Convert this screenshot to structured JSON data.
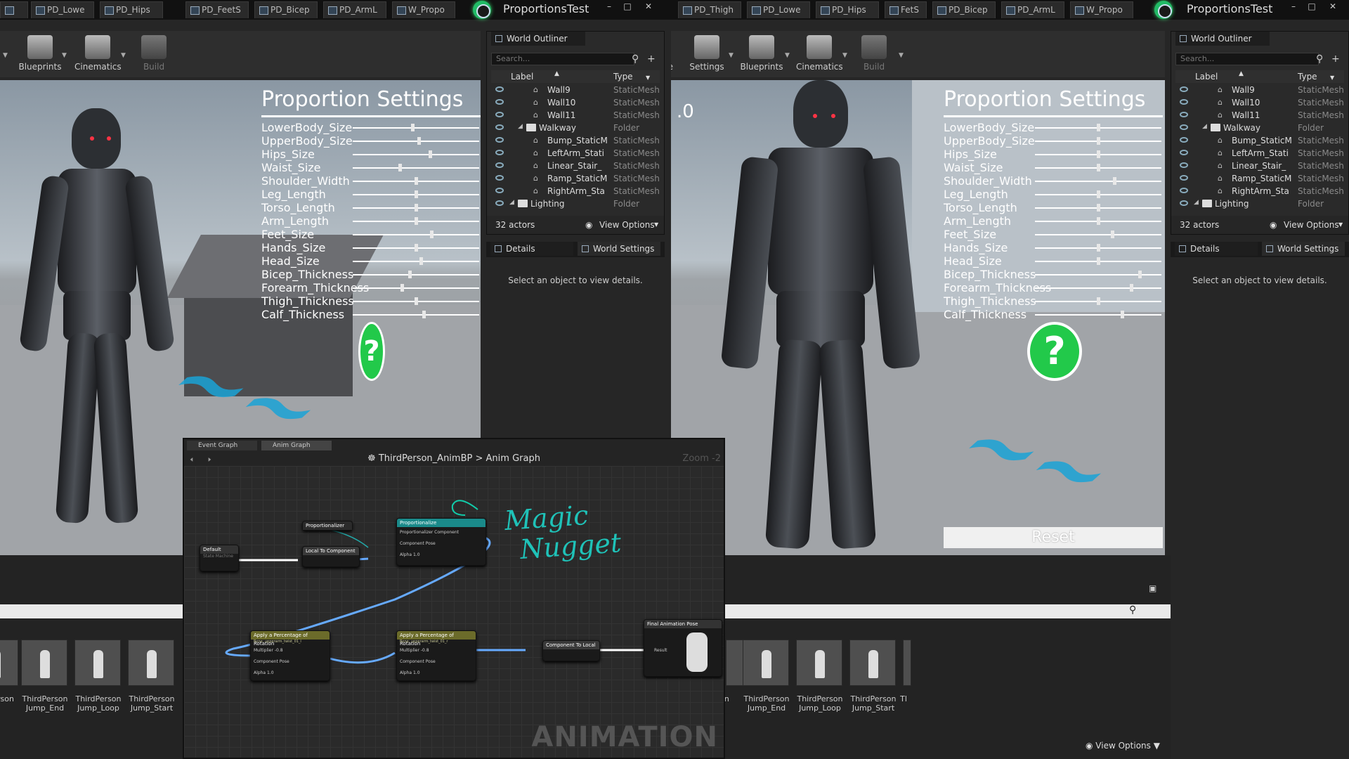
{
  "left": {
    "tabs": [
      "",
      "PD_Lowe",
      "PD_Hips",
      "PD_FeetS",
      "PD_Bicep",
      "PD_ArmL",
      "W_Propo"
    ],
    "app_title": "ProportionsTest",
    "toolbar": [
      {
        "label": "Blueprints",
        "icon": "blueprints-icon"
      },
      {
        "label": "Cinematics",
        "icon": "cinematics-icon"
      },
      {
        "label": "Build",
        "icon": "build-icon"
      }
    ],
    "viewport": {
      "title": "Proportion Settings",
      "sliders": [
        {
          "label": "LowerBody_Size",
          "value": 0.47
        },
        {
          "label": "UpperBody_Size",
          "value": 0.52
        },
        {
          "label": "Hips_Size",
          "value": 0.61
        },
        {
          "label": "Waist_Size",
          "value": 0.37
        },
        {
          "label": "Shoulder_Width",
          "value": 0.5
        },
        {
          "label": "Leg_Length",
          "value": 0.5
        },
        {
          "label": "Torso_Length",
          "value": 0.5
        },
        {
          "label": "Arm_Length",
          "value": 0.5
        },
        {
          "label": "Feet_Size",
          "value": 0.62
        },
        {
          "label": "Hands_Size",
          "value": 0.5
        },
        {
          "label": "Head_Size",
          "value": 0.54
        },
        {
          "label": "Bicep_Thickness",
          "value": 0.45
        },
        {
          "label": "Forearm_Thickness",
          "value": 0.39
        },
        {
          "label": "Thigh_Thickness",
          "value": 0.5
        },
        {
          "label": "Calf_Thickness",
          "value": 0.56
        }
      ],
      "help_icon": "?"
    },
    "outliner": {
      "tab": "World Outliner",
      "search_placeholder": "Search...",
      "col_label": "Label",
      "col_type": "Type",
      "rows": [
        {
          "label": "Wall9",
          "type": "StaticMesh",
          "kind": "mesh",
          "indent": 2
        },
        {
          "label": "Wall10",
          "type": "StaticMesh",
          "kind": "mesh",
          "indent": 2
        },
        {
          "label": "Wall11",
          "type": "StaticMesh",
          "kind": "mesh",
          "indent": 2
        },
        {
          "label": "Walkway",
          "type": "Folder",
          "kind": "folder",
          "indent": 1
        },
        {
          "label": "Bump_StaticM",
          "type": "StaticMesh",
          "kind": "mesh",
          "indent": 2
        },
        {
          "label": "LeftArm_Stati",
          "type": "StaticMesh",
          "kind": "mesh",
          "indent": 2
        },
        {
          "label": "Linear_Stair_",
          "type": "StaticMesh",
          "kind": "mesh",
          "indent": 2
        },
        {
          "label": "Ramp_StaticM",
          "type": "StaticMesh",
          "kind": "mesh",
          "indent": 2
        },
        {
          "label": "RightArm_Sta",
          "type": "StaticMesh",
          "kind": "mesh",
          "indent": 2
        },
        {
          "label": "Lighting",
          "type": "Folder",
          "kind": "folder",
          "indent": 0
        }
      ],
      "actor_count": "32 actors",
      "view_options": "View Options"
    },
    "details": {
      "tab": "Details",
      "tab2": "World Settings",
      "message": "Select an object to view details."
    },
    "content": {
      "items": [
        {
          "line1": "rson",
          "line2": ""
        },
        {
          "line1": "ThirdPerson",
          "line2": "Jump_End"
        },
        {
          "line1": "ThirdPerson",
          "line2": "Jump_Loop"
        },
        {
          "line1": "ThirdPerson",
          "line2": "Jump_Start"
        }
      ]
    }
  },
  "graph": {
    "tabs": [
      "Event Graph",
      "Anim Graph"
    ],
    "breadcrumb_root": "ThirdPerson_AnimBP",
    "breadcrumb_sep": ">",
    "breadcrumb_leaf": "Anim Graph",
    "zoom": "Zoom -2",
    "annotation_line1": "Magic",
    "annotation_line2": "Nugget",
    "watermark": "ANIMATION",
    "nodes": {
      "default": {
        "title": "Default",
        "subtitle": "State Machine"
      },
      "proportionalizer": {
        "title": "Proportionalizer"
      },
      "local_to_component": {
        "title": "Local To Component"
      },
      "proportionalize": {
        "title": "Proportionalize",
        "pin1": "Proportionalizer Component",
        "pin2": "Component Pose",
        "pin3": "Alpha",
        "alpha": "1.0"
      },
      "apply1": {
        "title": "Apply a Percentage of Rotation",
        "sub": "Bone: upperarm_twist_01_l",
        "pin1": "Multiplier",
        "mult": "-0.8",
        "pin2": "Component Pose",
        "pin3": "Alpha",
        "alpha": "1.0"
      },
      "apply2": {
        "title": "Apply a Percentage of Rotation",
        "sub": "Bone: upperarm_twist_01_r",
        "pin1": "Multiplier",
        "mult": "-0.8",
        "pin2": "Component Pose",
        "pin3": "Alpha",
        "alpha": "1.0"
      },
      "component_to_local": {
        "title": "Component To Local"
      },
      "final": {
        "title": "Final Animation Pose",
        "pin": "Result"
      }
    }
  },
  "right": {
    "tabs": [
      "PD_Thigh",
      "PD_Lowe",
      "PD_Hips",
      "FetS",
      "PD_Bicep",
      "PD_ArmL",
      "W_Propo"
    ],
    "app_title": "ProportionsTest",
    "toolbar": [
      {
        "label": "ce",
        "icon": ""
      },
      {
        "label": "Settings",
        "icon": "settings-icon"
      },
      {
        "label": "Blueprints",
        "icon": "blueprints-icon"
      },
      {
        "label": "Cinematics",
        "icon": "cinematics-icon"
      },
      {
        "label": "Build",
        "icon": "build-icon"
      }
    ],
    "viewport": {
      "corner_text": ".0",
      "title": "Proportion Settings",
      "sliders": [
        {
          "label": "LowerBody_Size",
          "value": 0.5
        },
        {
          "label": "UpperBody_Size",
          "value": 0.5
        },
        {
          "label": "Hips_Size",
          "value": 0.5
        },
        {
          "label": "Waist_Size",
          "value": 0.5
        },
        {
          "label": "Shoulder_Width",
          "value": 0.63
        },
        {
          "label": "Leg_Length",
          "value": 0.5
        },
        {
          "label": "Torso_Length",
          "value": 0.5
        },
        {
          "label": "Arm_Length",
          "value": 0.5
        },
        {
          "label": "Feet_Size",
          "value": 0.61
        },
        {
          "label": "Hands_Size",
          "value": 0.5
        },
        {
          "label": "Head_Size",
          "value": 0.5
        },
        {
          "label": "Bicep_Thickness",
          "value": 0.83
        },
        {
          "label": "Forearm_Thickness",
          "value": 0.76
        },
        {
          "label": "Thigh_Thickness",
          "value": 0.5
        },
        {
          "label": "Calf_Thickness",
          "value": 0.69
        }
      ],
      "help_icon": "?",
      "reset": "Reset"
    },
    "outliner": {
      "tab": "World Outliner",
      "search_placeholder": "Search...",
      "col_label": "Label",
      "col_type": "Type",
      "rows": [
        {
          "label": "Wall9",
          "type": "StaticMesh",
          "kind": "mesh",
          "indent": 2
        },
        {
          "label": "Wall10",
          "type": "StaticMesh",
          "kind": "mesh",
          "indent": 2
        },
        {
          "label": "Wall11",
          "type": "StaticMesh",
          "kind": "mesh",
          "indent": 2
        },
        {
          "label": "Walkway",
          "type": "Folder",
          "kind": "folder",
          "indent": 1
        },
        {
          "label": "Bump_StaticM",
          "type": "StaticMesh",
          "kind": "mesh",
          "indent": 2
        },
        {
          "label": "LeftArm_Stati",
          "type": "StaticMesh",
          "kind": "mesh",
          "indent": 2
        },
        {
          "label": "Linear_Stair_",
          "type": "StaticMesh",
          "kind": "mesh",
          "indent": 2
        },
        {
          "label": "Ramp_StaticM",
          "type": "StaticMesh",
          "kind": "mesh",
          "indent": 2
        },
        {
          "label": "RightArm_Sta",
          "type": "StaticMesh",
          "kind": "mesh",
          "indent": 2
        },
        {
          "label": "Lighting",
          "type": "Folder",
          "kind": "folder",
          "indent": 0
        }
      ],
      "actor_count": "32 actors",
      "view_options": "View Options"
    },
    "details": {
      "tab": "Details",
      "tab2": "World Settings",
      "message": "Select an object to view details."
    },
    "content": {
      "items": [
        {
          "line1": "on",
          "line2": ""
        },
        {
          "line1": "ThirdPerson",
          "line2": "Jump_End"
        },
        {
          "line1": "ThirdPerson",
          "line2": "Jump_Loop"
        },
        {
          "line1": "ThirdPerson",
          "line2": "Jump_Start"
        },
        {
          "line1": "Tl",
          "line2": ""
        }
      ],
      "view_options": "View Options"
    }
  }
}
